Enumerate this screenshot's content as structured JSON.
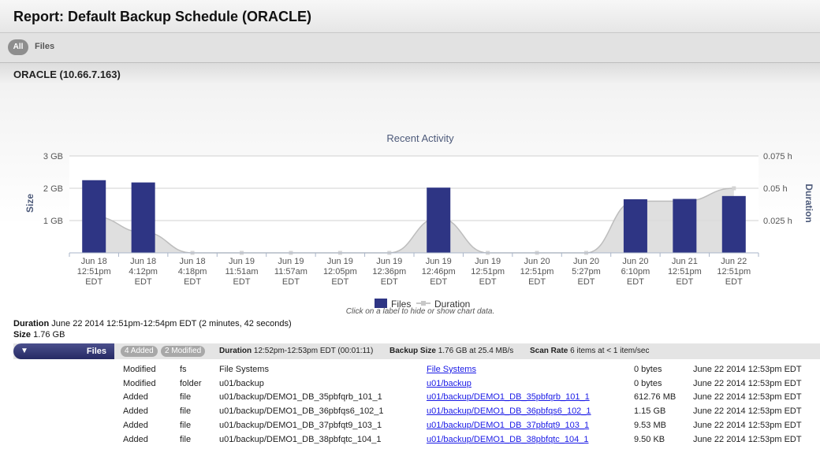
{
  "title": "Report: Default Backup Schedule (ORACLE)",
  "tabs": {
    "all": "All",
    "files": "Files"
  },
  "host": "ORACLE (10.66.7.163)",
  "chart_data": {
    "type": "bar",
    "title": "Recent Activity",
    "ylabel": "Size",
    "y2label": "Duration",
    "yticks": [
      "3 GB",
      "2 GB",
      "1 GB"
    ],
    "y2ticks": [
      "0.075 h",
      "0.05 h",
      "0.025 h"
    ],
    "ylim": [
      0,
      3
    ],
    "y2lim": [
      0,
      0.075
    ],
    "categories": [
      [
        "Jun 18",
        "12:51pm",
        "EDT"
      ],
      [
        "Jun 18",
        "4:12pm",
        "EDT"
      ],
      [
        "Jun 18",
        "4:18pm",
        "EDT"
      ],
      [
        "Jun 19",
        "11:51am",
        "EDT"
      ],
      [
        "Jun 19",
        "11:57am",
        "EDT"
      ],
      [
        "Jun 19",
        "12:05pm",
        "EDT"
      ],
      [
        "Jun 19",
        "12:36pm",
        "EDT"
      ],
      [
        "Jun 19",
        "12:46pm",
        "EDT"
      ],
      [
        "Jun 19",
        "12:51pm",
        "EDT"
      ],
      [
        "Jun 20",
        "12:51pm",
        "EDT"
      ],
      [
        "Jun 20",
        "5:27pm",
        "EDT"
      ],
      [
        "Jun 20",
        "6:10pm",
        "EDT"
      ],
      [
        "Jun 21",
        "12:51pm",
        "EDT"
      ],
      [
        "Jun 22",
        "12:51pm",
        "EDT"
      ]
    ],
    "series": [
      {
        "name": "Files",
        "type": "bar",
        "color": "#2e3584",
        "values": [
          2.25,
          2.18,
          0,
          0,
          0,
          0,
          0,
          2.02,
          0,
          0,
          0,
          1.66,
          1.67,
          1.76
        ]
      },
      {
        "name": "Duration",
        "type": "area",
        "color": "#c8c8c8",
        "values": [
          0.028,
          0.016,
          0,
          0,
          0,
          0,
          0,
          0.027,
          0,
          0,
          0,
          0.04,
          0.04,
          0.05
        ]
      }
    ],
    "legend": "bottom",
    "note": "Click on a label to hide or show chart data."
  },
  "summary": {
    "duration_label": "Duration",
    "duration_value": "June 22 2014 12:51pm-12:54pm EDT (2 minutes, 42 seconds)",
    "size_label": "Size",
    "size_value": "1.76 GB"
  },
  "filesbar": {
    "label": "Files",
    "added": "4 Added",
    "modified": "2 Modified",
    "duration_label": "Duration",
    "duration_value": "12:52pm-12:53pm EDT (00:01:11)",
    "backup_label": "Backup Size",
    "backup_value": "1.76 GB at 25.4 MB/s",
    "scan_label": "Scan Rate",
    "scan_value": "6 items at < 1 item/sec"
  },
  "rows": [
    {
      "action": "Modified",
      "type": "fs",
      "path": "File Systems",
      "link": "File Systems",
      "size": "0 bytes",
      "date": "June 22 2014 12:53pm EDT"
    },
    {
      "action": "Modified",
      "type": "folder",
      "path": "u01/backup",
      "link": "u01/backup",
      "size": "0 bytes",
      "date": "June 22 2014 12:53pm EDT"
    },
    {
      "action": "Added",
      "type": "file",
      "path": "u01/backup/DEMO1_DB_35pbfqrb_101_1",
      "link": "u01/backup/DEMO1_DB_35pbfqrb_101_1",
      "size": "612.76 MB",
      "date": "June 22 2014 12:53pm EDT"
    },
    {
      "action": "Added",
      "type": "file",
      "path": "u01/backup/DEMO1_DB_36pbfqs6_102_1",
      "link": "u01/backup/DEMO1_DB_36pbfqs6_102_1",
      "size": "1.15 GB",
      "date": "June 22 2014 12:53pm EDT"
    },
    {
      "action": "Added",
      "type": "file",
      "path": "u01/backup/DEMO1_DB_37pbfqt9_103_1",
      "link": "u01/backup/DEMO1_DB_37pbfqt9_103_1",
      "size": "9.53 MB",
      "date": "June 22 2014 12:53pm EDT"
    },
    {
      "action": "Added",
      "type": "file",
      "path": "u01/backup/DEMO1_DB_38pbfqtc_104_1",
      "link": "u01/backup/DEMO1_DB_38pbfqtc_104_1",
      "size": "9.50 KB",
      "date": "June 22 2014 12:53pm EDT"
    }
  ]
}
